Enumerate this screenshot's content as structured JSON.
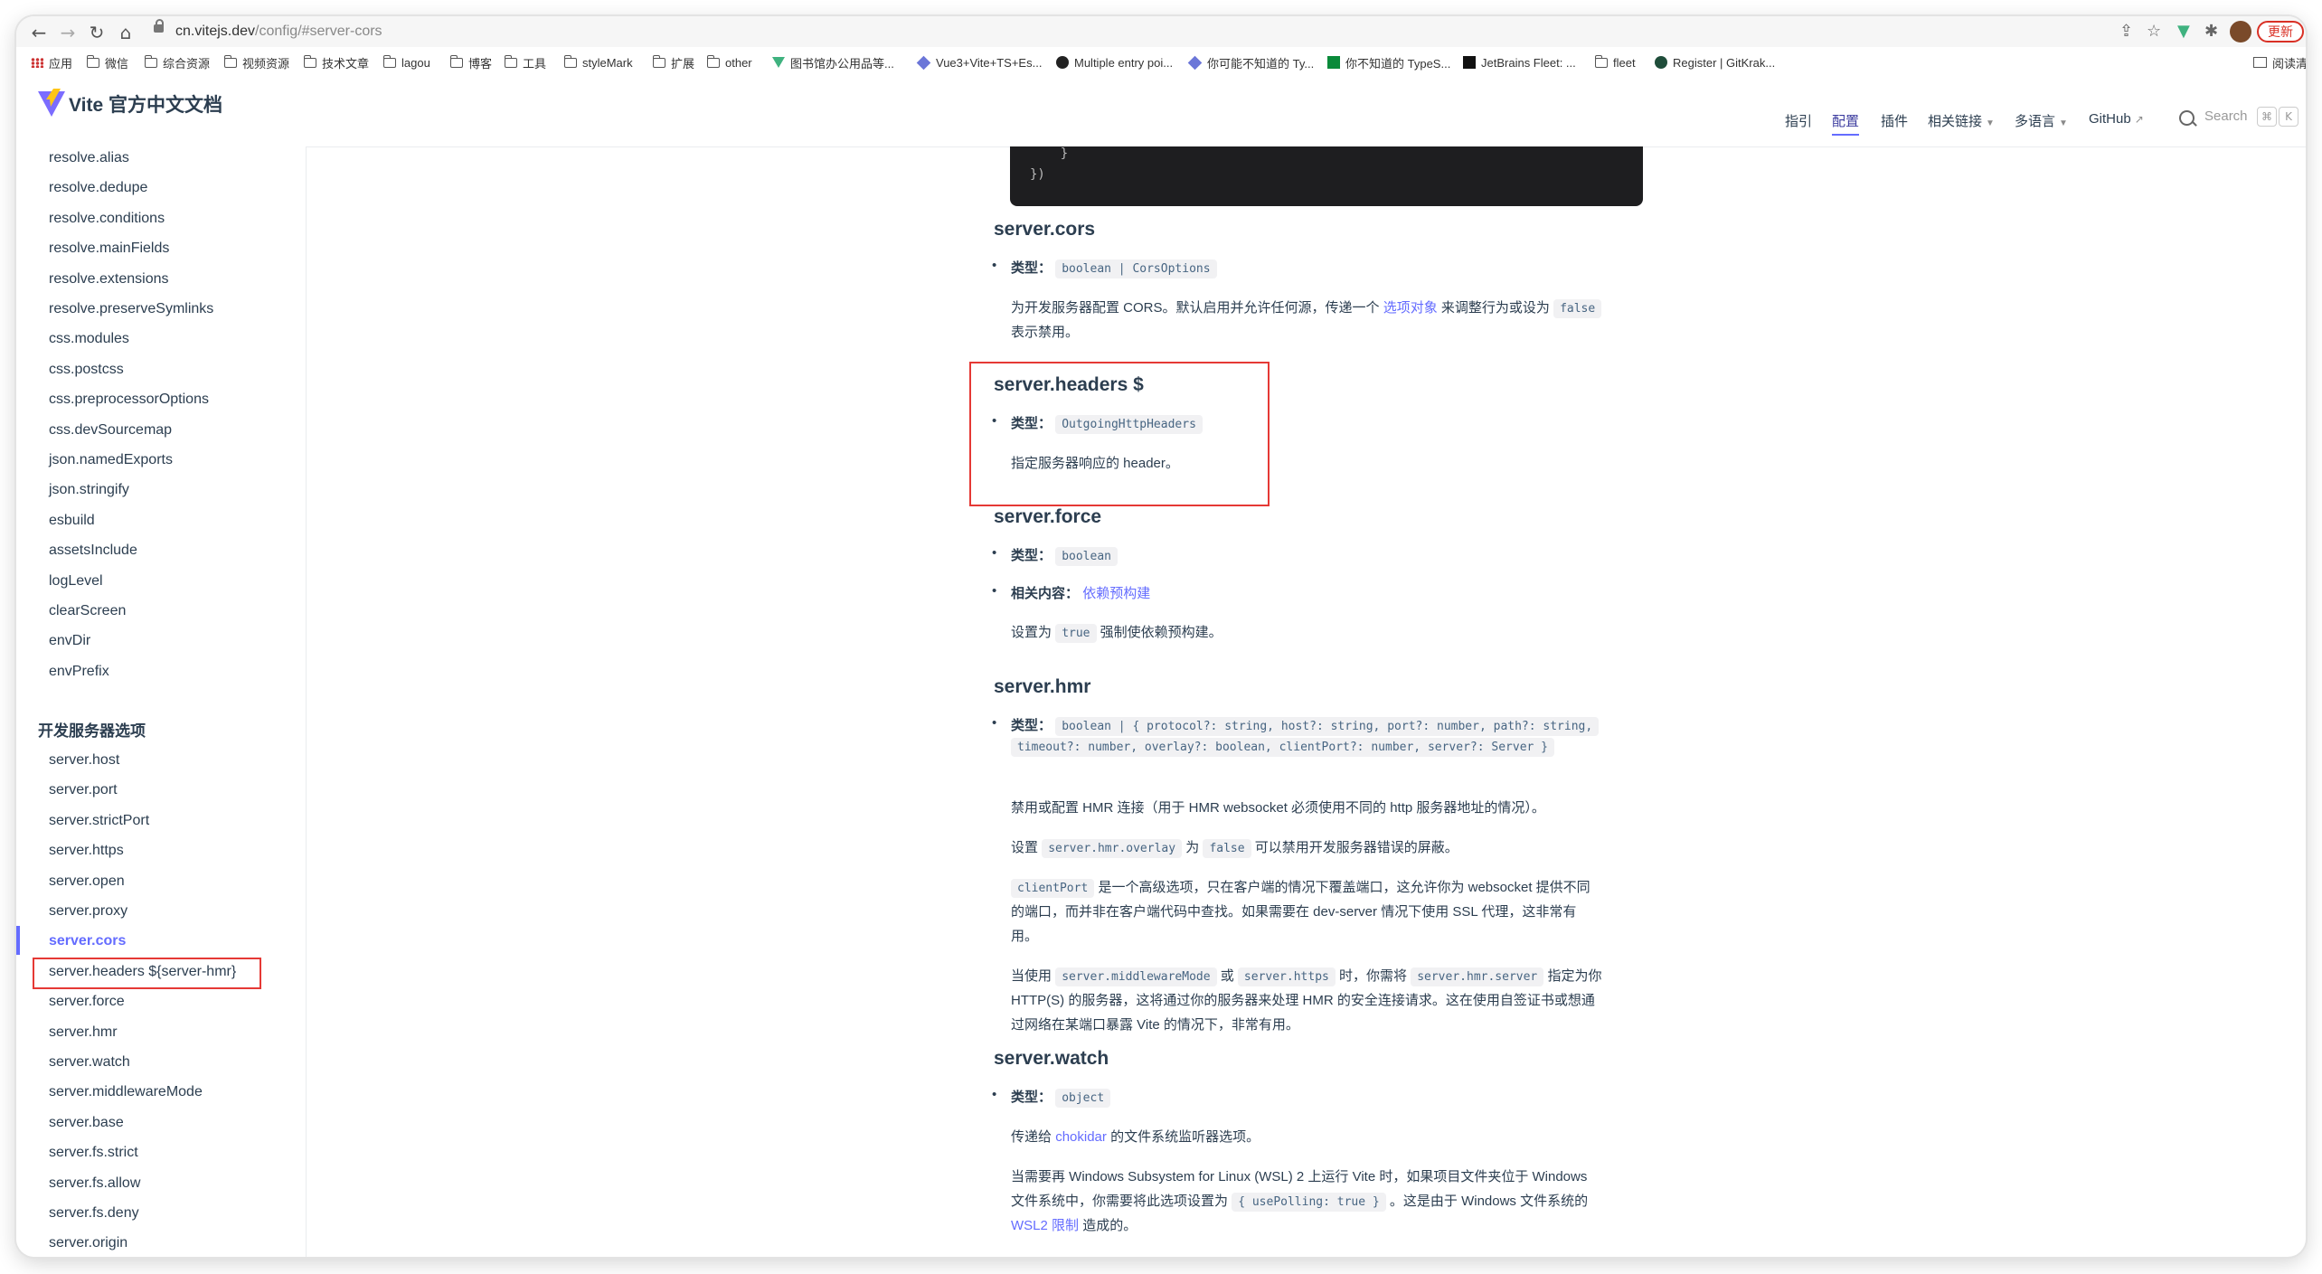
{
  "browser": {
    "url_host": "cn.vitejs.dev",
    "url_path": "/config/#server-cors",
    "update_label": "更新",
    "read_label": "阅读清",
    "bookmarks": [
      "应用",
      "微信",
      "综合资源",
      "视频资源",
      "技术文章",
      "lagou",
      "博客",
      "工具",
      "styleMark",
      "扩展",
      "other",
      "图书馆办公用品等...",
      "Vue3+Vite+TS+Es...",
      "Multiple entry poi...",
      "你可能不知道的 Ty...",
      "你不知道的 TypeS...",
      "JetBrains Fleet: ...",
      "fleet",
      "Register | GitKrak..."
    ]
  },
  "navbar": {
    "title": "Vite 官方中文文档",
    "links": [
      "指引",
      "配置",
      "插件",
      "相关链接",
      "多语言",
      "GitHub"
    ],
    "active": "配置",
    "search_placeholder": "Search",
    "kbd": [
      "⌘",
      "K"
    ]
  },
  "sidebar": {
    "items_a": [
      "resolve.alias",
      "resolve.dedupe",
      "resolve.conditions",
      "resolve.mainFields",
      "resolve.extensions",
      "resolve.preserveSymlinks",
      "css.modules",
      "css.postcss",
      "css.preprocessorOptions",
      "css.devSourcemap",
      "json.namedExports",
      "json.stringify",
      "esbuild",
      "assetsInclude",
      "logLevel",
      "clearScreen",
      "envDir",
      "envPrefix"
    ],
    "section_title": "开发服务器选项",
    "items_b": [
      "server.host",
      "server.port",
      "server.strictPort",
      "server.https",
      "server.open",
      "server.proxy",
      "server.cors",
      "server.headers ${server-hmr}",
      "server.force",
      "server.hmr",
      "server.watch",
      "server.middlewareMode",
      "server.base",
      "server.fs.strict",
      "server.fs.allow",
      "server.fs.deny",
      "server.origin"
    ],
    "active_item": "server.cors"
  },
  "content": {
    "code_lines": [
      "    }",
      "})"
    ],
    "type_label": "类型：",
    "related_label": "相关内容：",
    "cors": {
      "title": "server.cors",
      "type": "boolean | CorsOptions",
      "desc_1": "为开发服务器配置 CORS。默认启用并允许任何源，传递一个",
      "desc_link": "选项对象",
      "desc_2": "来调整行为或设为",
      "desc_code": "false",
      "desc_3": "表示禁用。"
    },
    "headers": {
      "title": "server.headers $",
      "type": "OutgoingHttpHeaders",
      "desc": "指定服务器响应的 header。"
    },
    "force": {
      "title": "server.force",
      "type": "boolean",
      "related_link": "依赖预构建",
      "desc_1": "设置为",
      "desc_code": "true",
      "desc_2": "强制使依赖预构建。"
    },
    "hmr": {
      "title": "server.hmr",
      "type_1": "boolean | { protocol?: string, host?: string, port?: number, path?: string,",
      "type_2": "timeout?: number, overlay?: boolean, clientPort?: number, server?: Server }",
      "p1": "禁用或配置 HMR 连接（用于 HMR websocket 必须使用不同的 http 服务器地址的情况）。",
      "p2_a": "设置",
      "p2_code1": "server.hmr.overlay",
      "p2_b": "为",
      "p2_code2": "false",
      "p2_c": "可以禁用开发服务器错误的屏蔽。",
      "p3_code": "clientPort",
      "p3_l1": "是一个高级选项，只在客户端的情况下覆盖端口，这允许你为 websocket 提供不同",
      "p3_l2": "的端口，而并非在客户端代码中查找。如果需要在 dev-server 情况下使用 SSL 代理，这非常有",
      "p3_l3": "用。",
      "p4_a": "当使用",
      "p4_code1": "server.middlewareMode",
      "p4_b": "或",
      "p4_code2": "server.https",
      "p4_c": "时，你需将",
      "p4_code3": "server.hmr.server",
      "p4_d": "指定为你",
      "p4_l2": "HTTP(S) 的服务器，这将通过你的服务器来处理 HMR 的安全连接请求。这在使用自签证书或想通",
      "p4_l3": "过网络在某端口暴露 Vite 的情况下，非常有用。"
    },
    "watch": {
      "title": "server.watch",
      "type": "object",
      "p1_a": "传递给",
      "p1_link": "chokidar",
      "p1_b": "的文件系统监听器选项。",
      "p2_l1": "当需要再 Windows Subsystem for Linux (WSL) 2 上运行 Vite 时，如果项目文件夹位于 Windows",
      "p2_l2a": "文件系统中，你需要将此选项设置为",
      "p2_code": "{ usePolling: true }",
      "p2_l2b": "。这是由于 Windows 文件系统的",
      "p2_link": "WSL2 限制",
      "p2_l3": "造成的。"
    }
  }
}
